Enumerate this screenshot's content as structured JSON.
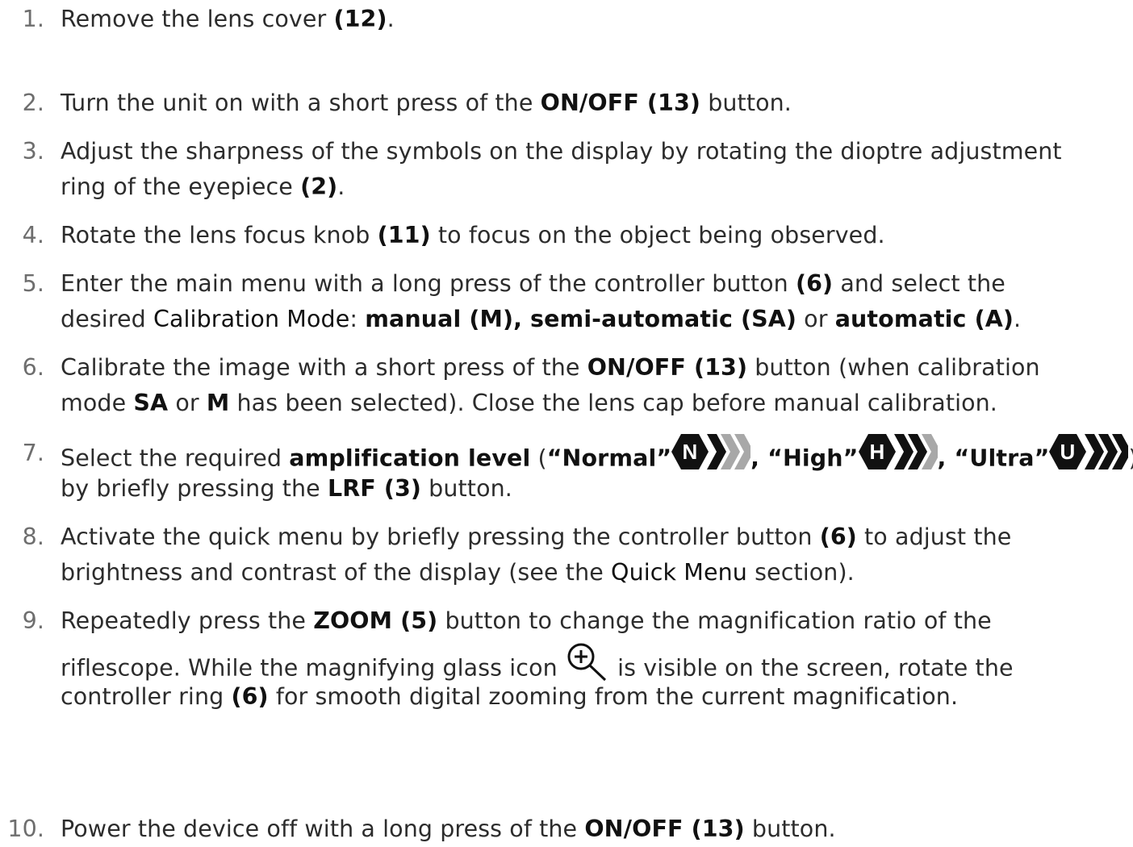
{
  "steps": [
    {
      "num": "1.",
      "lines": [
        [
          {
            "t": "Remove the lens cover "
          },
          {
            "t": "(12)",
            "b": true
          },
          {
            "t": "."
          }
        ]
      ]
    },
    {
      "num": "2.",
      "lines": [
        [
          {
            "t": "Turn the unit on with a short press of the "
          },
          {
            "t": "ON/OFF (13)",
            "b": true
          },
          {
            "t": " button."
          }
        ]
      ]
    },
    {
      "num": "3.",
      "lines": [
        [
          {
            "t": "Adjust the sharpness of the symbols on the display by rotating the dioptre adjustment"
          }
        ],
        [
          {
            "t": "ring of the eyepiece "
          },
          {
            "t": "(2)",
            "b": true
          },
          {
            "t": "."
          }
        ]
      ]
    },
    {
      "num": "4.",
      "lines": [
        [
          {
            "t": "Rotate the lens focus knob "
          },
          {
            "t": "(11)",
            "b": true
          },
          {
            "t": " to focus on the object being observed."
          }
        ]
      ]
    },
    {
      "num": "5.",
      "lines": [
        [
          {
            "t": "Enter the main menu with a long press of the controller button "
          },
          {
            "t": "(6)",
            "b": true
          },
          {
            "t": " and select the"
          }
        ],
        [
          {
            "t": "desired "
          },
          {
            "t": "Calibration Mode",
            "em": true
          },
          {
            "t": ": "
          },
          {
            "t": "manual (M), semi-automatic (SA)",
            "b": true
          },
          {
            "t": " or "
          },
          {
            "t": "automatic (A)",
            "b": true
          },
          {
            "t": "."
          }
        ]
      ]
    },
    {
      "num": "6.",
      "lines": [
        [
          {
            "t": "Calibrate the image with a short press of the "
          },
          {
            "t": "ON/OFF (13)",
            "b": true
          },
          {
            "t": " button (when calibration"
          }
        ],
        [
          {
            "t": "mode "
          },
          {
            "t": "SA",
            "b": true
          },
          {
            "t": " or "
          },
          {
            "t": "M",
            "b": true
          },
          {
            "t": " has been selected). Close the lens cap before manual calibration."
          }
        ]
      ]
    },
    {
      "num": "7.",
      "lines": [
        [
          {
            "t": "Select the required "
          },
          {
            "t": "amplification level",
            "b": true
          },
          {
            "t": " ("
          },
          {
            "t": "“Normal”",
            "b": true
          },
          {
            "badge": "N",
            "active": 1
          },
          {
            "t": ", “High”",
            "b": true
          },
          {
            "badge": "H",
            "active": 2
          },
          {
            "t": ", “Ultra”",
            "b": true
          },
          {
            "badge": "U",
            "active": 3
          },
          {
            "t": ")"
          }
        ],
        [
          {
            "t": "by briefly pressing the "
          },
          {
            "t": "LRF (3)",
            "b": true
          },
          {
            "t": " button."
          }
        ]
      ]
    },
    {
      "num": "8.",
      "lines": [
        [
          {
            "t": "Activate the quick menu by briefly pressing the controller button "
          },
          {
            "t": "(6)",
            "b": true
          },
          {
            "t": " to adjust the"
          }
        ],
        [
          {
            "t": "brightness and contrast of the display (see the "
          },
          {
            "t": "Quick Menu",
            "em": true
          },
          {
            "t": " section)."
          }
        ]
      ]
    },
    {
      "num": "9.",
      "lines": [
        [
          {
            "t": "Repeatedly press the "
          },
          {
            "t": "ZOOM (5)",
            "b": true
          },
          {
            "t": " button to change the magnification ratio of the"
          }
        ],
        [
          {
            "t": "riflescope. While the magnifying glass icon "
          },
          {
            "icon": "zoom-in-icon"
          },
          {
            "t": " is visible on the screen, rotate the"
          }
        ],
        [
          {
            "t": "controller ring "
          },
          {
            "t": "(6)",
            "b": true
          },
          {
            "t": " for smooth digital zooming from the current magnification."
          }
        ]
      ]
    },
    {
      "num": "10.",
      "lines": [
        [
          {
            "t": "Power the device off with a long press of the "
          },
          {
            "t": "ON/OFF (13)",
            "b": true
          },
          {
            "t": " button."
          }
        ]
      ]
    }
  ],
  "colors": {
    "text": "#2c2c2c",
    "number": "#6e6e6e",
    "badge_dark": "#111111",
    "badge_light": "#a8a8a8"
  }
}
